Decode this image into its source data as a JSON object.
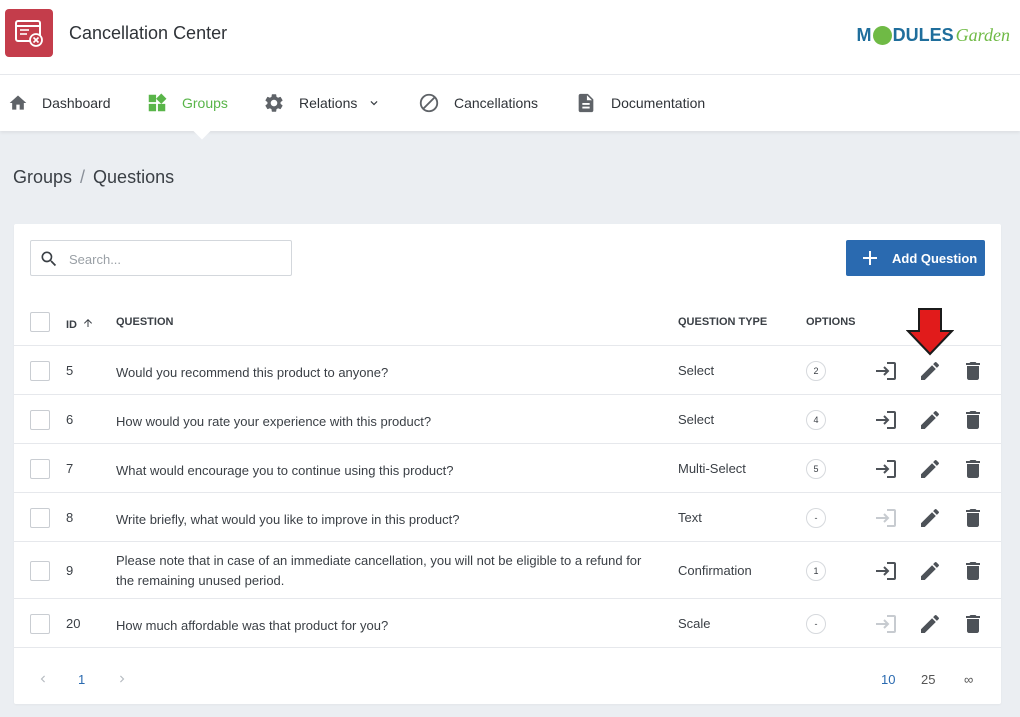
{
  "header": {
    "app_title": "Cancellation Center",
    "brand_part1": "M",
    "brand_part2": "DULES",
    "brand_part3": "Garden"
  },
  "nav": {
    "items": [
      {
        "label": "Dashboard",
        "icon": "home-icon"
      },
      {
        "label": "Groups",
        "icon": "widgets-icon",
        "active": true
      },
      {
        "label": "Relations",
        "icon": "gear-icon",
        "dropdown": true
      },
      {
        "label": "Cancellations",
        "icon": "block-icon"
      },
      {
        "label": "Documentation",
        "icon": "document-icon"
      }
    ]
  },
  "breadcrumb": {
    "parent": "Groups",
    "separator": "/",
    "current": "Questions"
  },
  "toolbar": {
    "search_placeholder": "Search...",
    "add_label": "Add Question"
  },
  "table": {
    "columns": {
      "id": "ID",
      "question": "QUESTION",
      "type": "QUESTION TYPE",
      "options": "OPTIONS"
    },
    "rows": [
      {
        "id": "5",
        "question": "Would you recommend this product to anyone?",
        "type": "Select",
        "options": "2",
        "move_enabled": true
      },
      {
        "id": "6",
        "question": "How would you rate your experience with this product?",
        "type": "Select",
        "options": "4",
        "move_enabled": true
      },
      {
        "id": "7",
        "question": "What would encourage you to continue using this product?",
        "type": "Multi-Select",
        "options": "5",
        "move_enabled": true
      },
      {
        "id": "8",
        "question": "Write briefly, what would you like to improve in this product?",
        "type": "Text",
        "options": "-",
        "move_enabled": false
      },
      {
        "id": "9",
        "question": "Please note that in case of an immediate cancellation, you will not be eligible to a refund for the remaining unused period.",
        "type": "Confirmation",
        "options": "1",
        "move_enabled": true
      },
      {
        "id": "20",
        "question": "How much affordable was that product for you?",
        "type": "Scale",
        "options": "-",
        "move_enabled": false
      }
    ]
  },
  "pagination": {
    "current_page": "1",
    "per_page_options": [
      "10",
      "25",
      "∞"
    ],
    "selected_per_page": "10"
  },
  "colors": {
    "accent_green": "#59b549",
    "primary_blue": "#2a6ab0",
    "logo_red": "#c43d4b",
    "annotation_red": "#e11b1b"
  }
}
